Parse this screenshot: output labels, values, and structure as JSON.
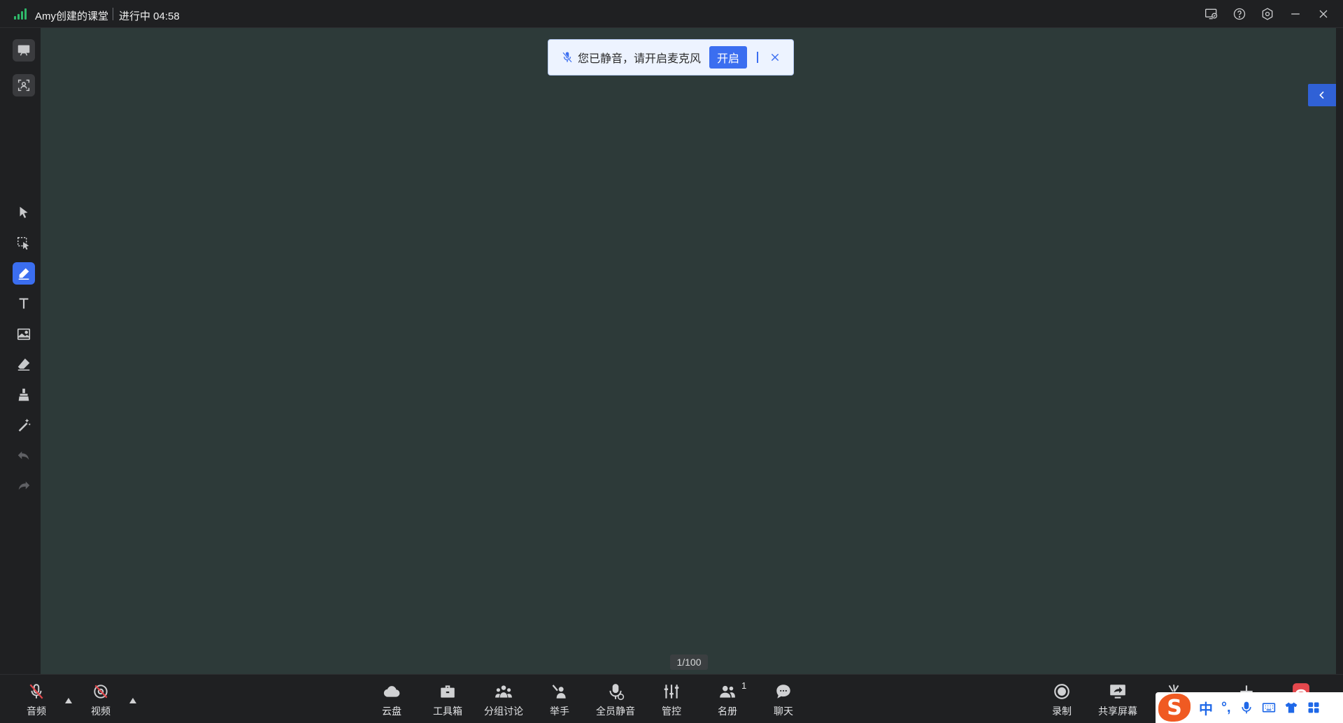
{
  "titlebar": {
    "title": "Amy创建的课堂",
    "status": "进行中 04:58",
    "icons": [
      "screen-cast-icon",
      "help-icon",
      "settings-icon",
      "minimize-icon",
      "close-icon"
    ]
  },
  "left_toolbar": {
    "items": [
      {
        "name": "whiteboard-icon",
        "state": "normal"
      },
      {
        "name": "camera-layout-icon",
        "state": "normal"
      },
      {
        "name": "cursor-icon",
        "state": "normal"
      },
      {
        "name": "select-area-icon",
        "state": "normal"
      },
      {
        "name": "pen-icon",
        "state": "active"
      },
      {
        "name": "text-icon",
        "state": "normal"
      },
      {
        "name": "image-icon",
        "state": "normal"
      },
      {
        "name": "eraser-icon",
        "state": "normal"
      },
      {
        "name": "brush-clear-icon",
        "state": "normal"
      },
      {
        "name": "laser-pointer-icon",
        "state": "normal"
      },
      {
        "name": "undo-icon",
        "state": "disabled"
      },
      {
        "name": "redo-icon",
        "state": "disabled"
      }
    ]
  },
  "notice": {
    "text": "您已静音，请开启麦克风",
    "button": "开启"
  },
  "board": {
    "page": "1/100",
    "background": "#2d3a39"
  },
  "bottom_bar": {
    "audio": "音频",
    "video": "视频",
    "cloud": "云盘",
    "toolbox": "工具箱",
    "breakout": "分组讨论",
    "raise_hand": "举手",
    "mute_all": "全员静音",
    "control": "管控",
    "roster": "名册",
    "roster_count": "1",
    "chat": "聊天",
    "record": "录制",
    "share_screen": "共享屏幕"
  },
  "ime": {
    "mode": "中",
    "punct": "°,"
  },
  "colors": {
    "accent": "#3b6ef0",
    "alert_red": "#e5484d",
    "signal_green": "#2fb86a"
  }
}
